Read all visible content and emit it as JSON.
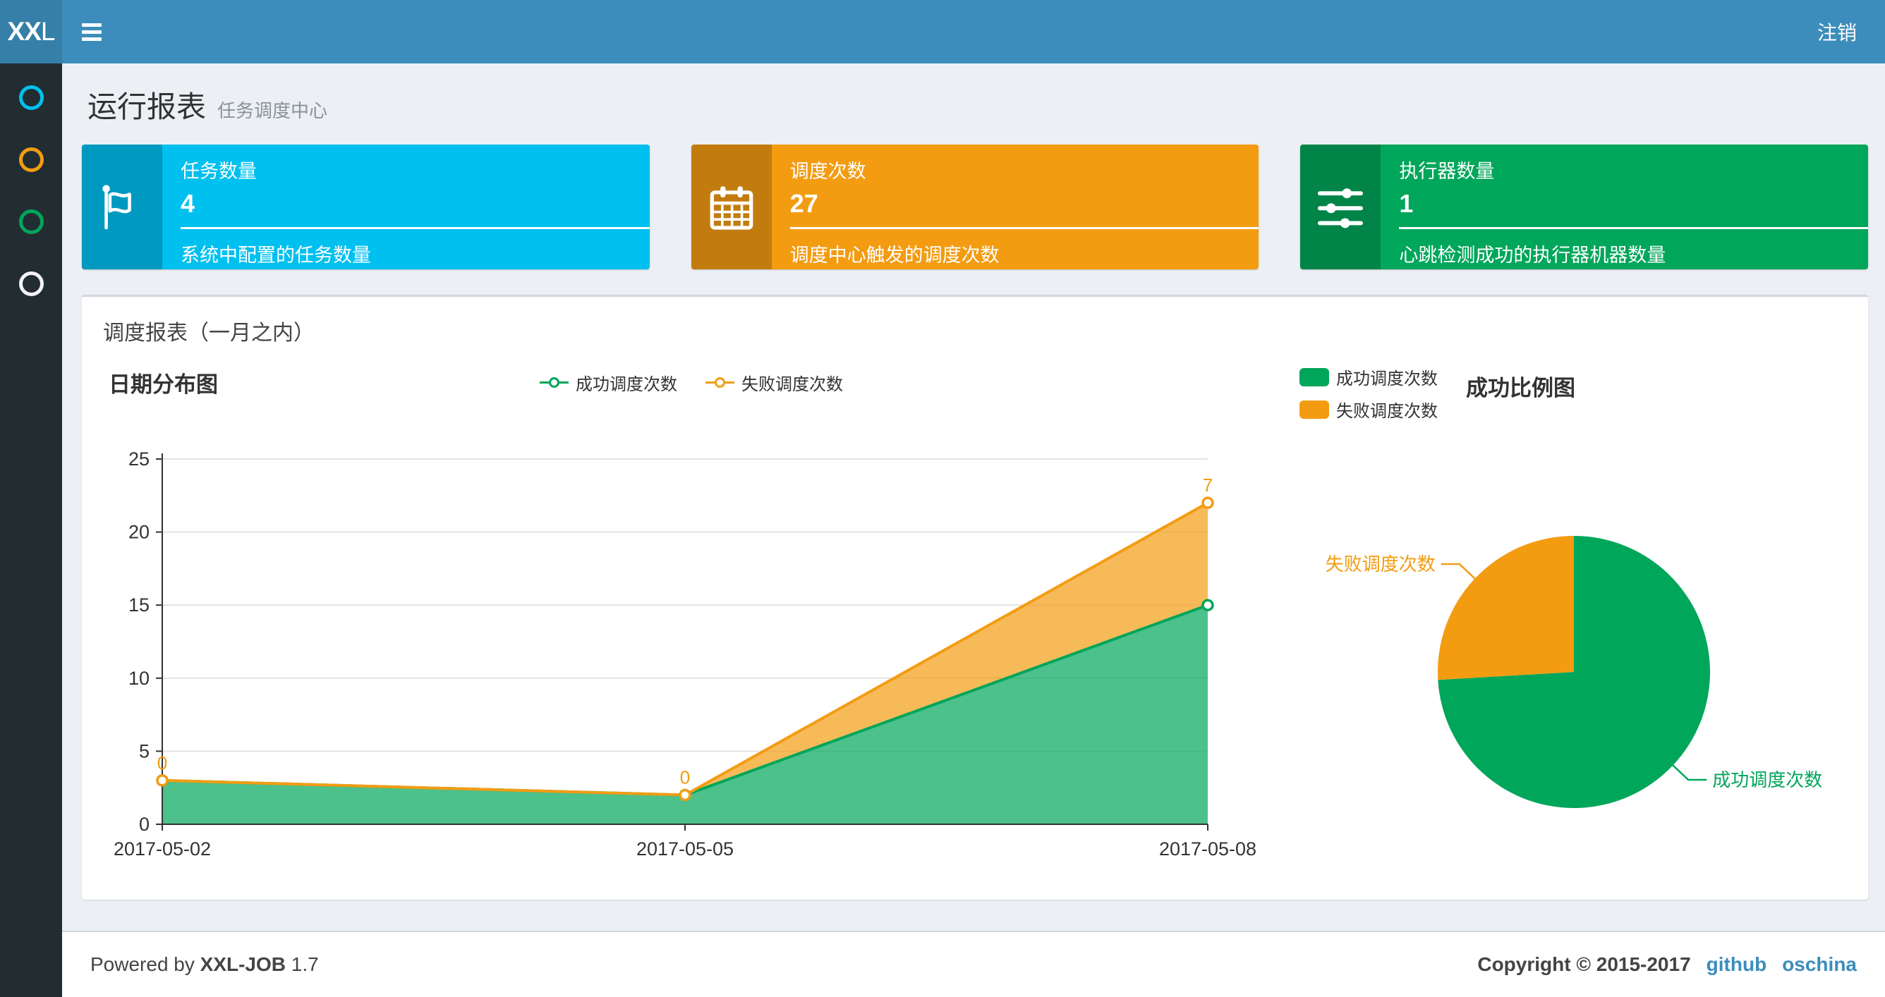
{
  "navbar": {
    "logo_bold": "XX",
    "logo_light": "L",
    "logout_label": "注销"
  },
  "sidebar": {
    "items": [
      {
        "name": "menu-item-1",
        "color": "#00c0ef"
      },
      {
        "name": "menu-item-2",
        "color": "#f39c12"
      },
      {
        "name": "menu-item-3",
        "color": "#00a65a"
      },
      {
        "name": "menu-item-4",
        "color": "#f4f4f5"
      }
    ]
  },
  "header": {
    "title": "运行报表",
    "subtitle": "任务调度中心"
  },
  "info_boxes": [
    {
      "icon": "flag-icon",
      "label": "任务数量",
      "value": "4",
      "desc": "系统中配置的任务数量",
      "color": "#00c0ef"
    },
    {
      "icon": "calendar-icon",
      "label": "调度次数",
      "value": "27",
      "desc": "调度中心触发的调度次数",
      "color": "#f39c12"
    },
    {
      "icon": "sliders-icon",
      "label": "执行器数量",
      "value": "1",
      "desc": "心跳检测成功的执行器机器数量",
      "color": "#00a65a"
    }
  ],
  "panel": {
    "title": "调度报表（一月之内）"
  },
  "chart_data": [
    {
      "type": "area",
      "title": "日期分布图",
      "categories": [
        "2017-05-02",
        "2017-05-05",
        "2017-05-08"
      ],
      "series": [
        {
          "name": "成功调度次数",
          "values": [
            3,
            2,
            15
          ],
          "color": "#00A65A",
          "show_labels": false
        },
        {
          "name": "失败调度次数",
          "values": [
            0,
            0,
            7
          ],
          "color": "#F39C12",
          "show_labels": true
        }
      ],
      "stacked": true,
      "ylim": [
        0,
        25
      ],
      "yticks": [
        0,
        5,
        10,
        15,
        20,
        25
      ],
      "grid": true,
      "legend_position": "top-center",
      "axis_color": "#333333",
      "grid_color": "#e3e3e3",
      "area_opacity": 0.7
    },
    {
      "type": "pie",
      "title": "成功比例图",
      "slices": [
        {
          "name": "成功调度次数",
          "value": 20,
          "color": "#00A65A"
        },
        {
          "name": "失败调度次数",
          "value": 7,
          "color": "#F39C12"
        }
      ],
      "total": 27,
      "start_angle_deg": -90,
      "direction": "clockwise",
      "legend_position": "top-left"
    }
  ],
  "footer": {
    "powered_prefix": "Powered by",
    "brand": "XXL-JOB",
    "version": "1.7",
    "copyright": "Copyright © 2015-2017",
    "links": [
      {
        "label": "github"
      },
      {
        "label": "oschina"
      }
    ]
  }
}
